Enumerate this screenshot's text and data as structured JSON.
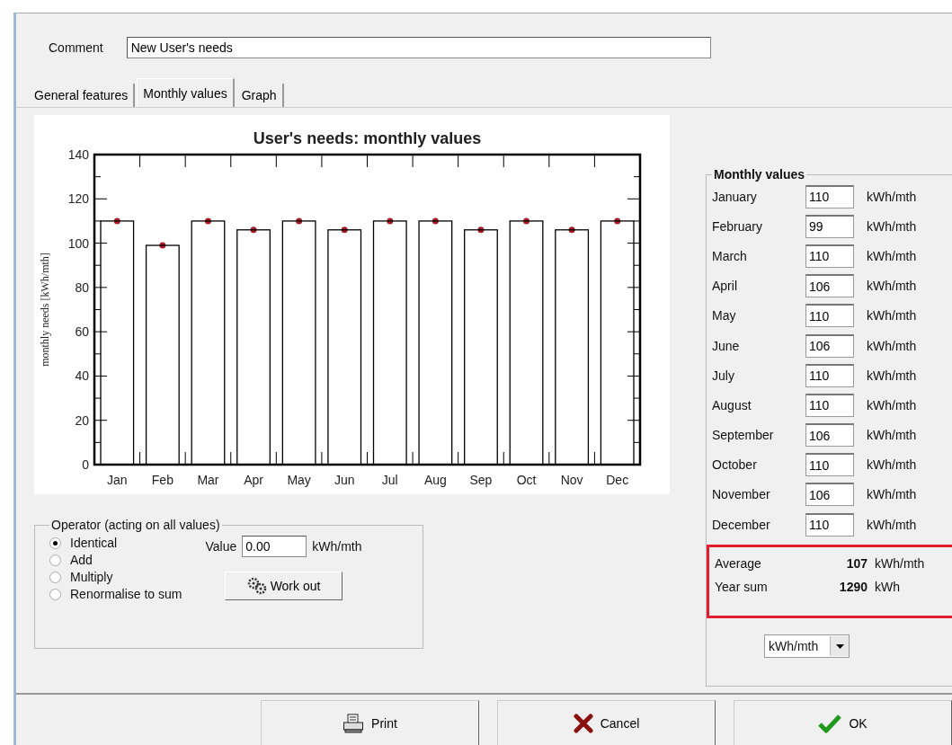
{
  "comment": {
    "label": "Comment",
    "value": "New User's needs"
  },
  "tabs": [
    {
      "label": "General features",
      "selected": false
    },
    {
      "label": "Monthly values",
      "selected": true
    },
    {
      "label": "Graph",
      "selected": false
    }
  ],
  "chart": {
    "chart_data": {
      "type": "bar",
      "title": "User's needs: monthly values",
      "ylabel": "monthly needs [kWh/mth]",
      "categories": [
        "Jan",
        "Feb",
        "Mar",
        "Apr",
        "May",
        "Jun",
        "Jul",
        "Aug",
        "Sep",
        "Oct",
        "Nov",
        "Dec"
      ],
      "values": [
        110,
        99,
        110,
        106,
        110,
        106,
        110,
        110,
        106,
        110,
        106,
        110
      ],
      "ylim": [
        0,
        140
      ],
      "yticks": [
        0,
        20,
        40,
        60,
        80,
        100,
        120,
        140
      ]
    }
  },
  "operator": {
    "title": "Operator  (acting on all values)",
    "options": [
      {
        "label": "Identical",
        "selected": true
      },
      {
        "label": "Add",
        "selected": false
      },
      {
        "label": "Multiply",
        "selected": false
      },
      {
        "label": "Renormalise to sum",
        "selected": false
      }
    ],
    "value_label": "Value",
    "value": "0.00",
    "value_unit": "kWh/mth",
    "work_out_button": "Work out"
  },
  "monthly_values": {
    "title": "Monthly values",
    "months": [
      {
        "name": "January",
        "value": "110",
        "unit": "kWh/mth"
      },
      {
        "name": "February",
        "value": "99",
        "unit": "kWh/mth"
      },
      {
        "name": "March",
        "value": "110",
        "unit": "kWh/mth"
      },
      {
        "name": "April",
        "value": "106",
        "unit": "kWh/mth"
      },
      {
        "name": "May",
        "value": "110",
        "unit": "kWh/mth"
      },
      {
        "name": "June",
        "value": "106",
        "unit": "kWh/mth"
      },
      {
        "name": "July",
        "value": "110",
        "unit": "kWh/mth"
      },
      {
        "name": "August",
        "value": "110",
        "unit": "kWh/mth"
      },
      {
        "name": "September",
        "value": "106",
        "unit": "kWh/mth"
      },
      {
        "name": "October",
        "value": "110",
        "unit": "kWh/mth"
      },
      {
        "name": "November",
        "value": "106",
        "unit": "kWh/mth"
      },
      {
        "name": "December",
        "value": "110",
        "unit": "kWh/mth"
      }
    ],
    "summary": {
      "highlighted": true,
      "rows": [
        {
          "label": "Average",
          "value": "107",
          "unit": "kWh/mth"
        },
        {
          "label": "Year sum",
          "value": "1290",
          "unit": "kWh"
        }
      ]
    },
    "unit_select": "kWh/mth"
  },
  "buttons": [
    {
      "kind": "print",
      "label": "Print"
    },
    {
      "kind": "cancel",
      "label": "Cancel"
    },
    {
      "kind": "ok",
      "label": "OK"
    }
  ]
}
